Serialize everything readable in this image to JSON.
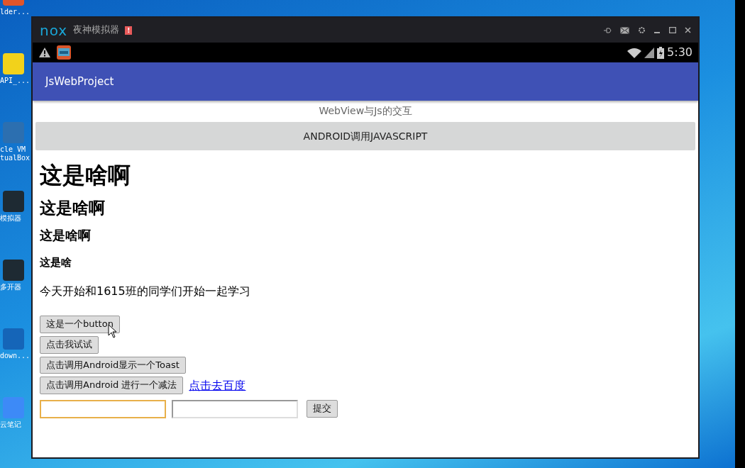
{
  "desktop": {
    "icons": [
      {
        "label": "lder...",
        "color": "#e0552b"
      },
      {
        "label": "API_...",
        "color": "#f2d21b"
      },
      {
        "label": "cle VM tualBox",
        "color": "#2c6fb0"
      },
      {
        "label": "模拟器",
        "color": "#1e2a33"
      },
      {
        "label": "多开器",
        "color": "#1e2a33"
      },
      {
        "label": "down...",
        "color": "#1565b8"
      },
      {
        "label": "云笔记",
        "color": "#3d8af7"
      }
    ]
  },
  "window": {
    "logo": "nox",
    "title": "夜神模拟器",
    "alert": "!"
  },
  "status_bar": {
    "time": "5:30"
  },
  "app_bar": {
    "title": "JsWebProject"
  },
  "page": {
    "heading": "WebView与Js的交互",
    "banner_button": "ANDROID调用JAVASCRIPT",
    "headings": [
      {
        "kind": "h1",
        "text": "这是啥啊"
      },
      {
        "kind": "h2",
        "text": "这是啥啊"
      },
      {
        "kind": "h3",
        "text": "这是啥啊"
      },
      {
        "kind": "h4",
        "text": "这是啥"
      }
    ],
    "paragraph": "今天开始和1615班的同学们开始一起学习",
    "buttons": [
      "这是一个button",
      "点击我试试",
      "点击调用Android显示一个Toast",
      "点击调用Android 进行一个减法"
    ],
    "link": "点击去百度",
    "inputs": [
      {
        "focused": true
      },
      {
        "focused": false
      }
    ],
    "submit": "提交"
  }
}
